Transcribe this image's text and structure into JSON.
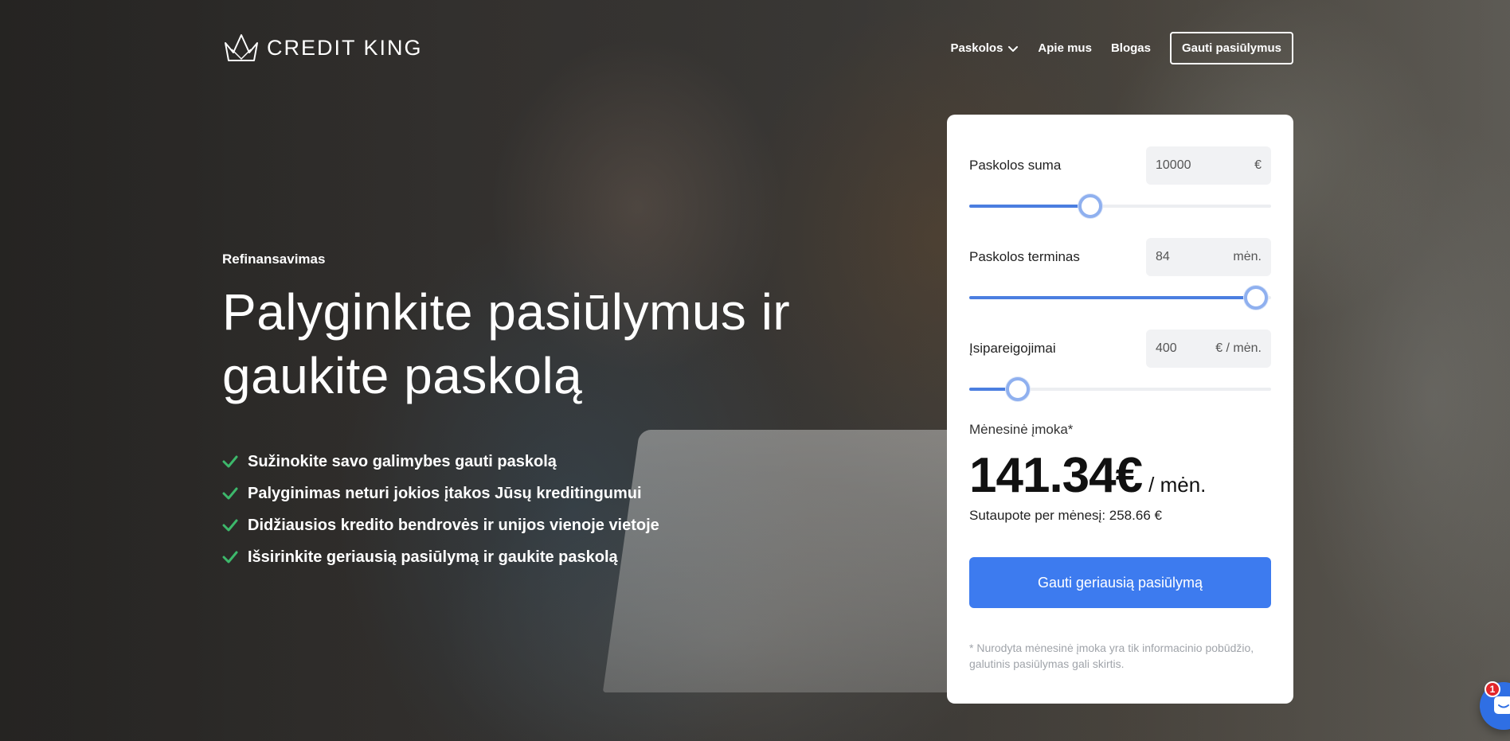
{
  "brand": {
    "name": "CREDIT KING",
    "logo_icon": "crown-icon"
  },
  "nav": {
    "items": [
      {
        "label": "Paskolos",
        "has_dropdown": true
      },
      {
        "label": "Apie mus"
      },
      {
        "label": "Blogas"
      }
    ],
    "cta_label": "Gauti pasiūlymus"
  },
  "hero": {
    "eyebrow": "Refinansavimas",
    "headline_line1": "Palyginkite pasiūlymus ir",
    "headline_line2": "gaukite paskolą",
    "checks": [
      "Sužinokite savo galimybes gauti paskolą",
      "Palyginimas neturi jokios įtakos Jūsų kreditingumui",
      "Didžiausios kredito bendrovės ir unijos vienoje vietoje",
      "Išsirinkite geriausią pasiūlymą ir gaukite paskolą"
    ],
    "check_color": "#3db86b"
  },
  "calculator": {
    "amount": {
      "label": "Paskolos suma",
      "value": "10000",
      "unit": "€",
      "slider_fraction": 0.4
    },
    "term": {
      "label": "Paskolos terminas",
      "value": "84",
      "unit": "mėn.",
      "slider_fraction": 0.95
    },
    "obligations": {
      "label": "Įsipareigojimai",
      "value": "400",
      "unit": "€ / mėn.",
      "slider_fraction": 0.16
    },
    "monthly_label": "Mėnesinė įmoka*",
    "monthly_amount": "141.34€",
    "monthly_unit": "/ mėn.",
    "savings": "Sutaupote per mėnesį: 258.66 €",
    "cta_label": "Gauti geriausią pasiūlymą",
    "disclaimer": "* Nurodyta mėnesinė įmoka yra tik informacinio pobūdžio, galutinis pasiūlymas gali skirtis.",
    "accent": "#3d7bef"
  },
  "chat": {
    "icon": "chat-icon",
    "badge": "1"
  }
}
